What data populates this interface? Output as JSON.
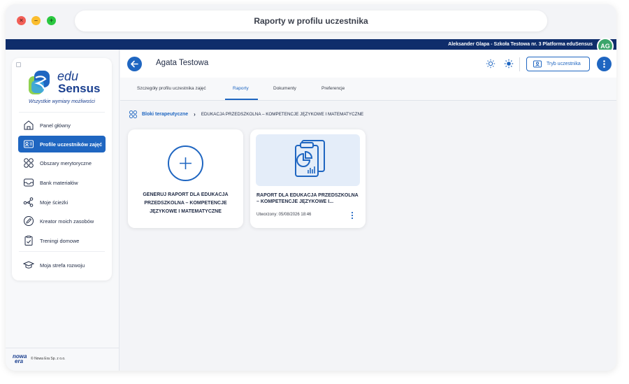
{
  "window": {
    "title": "Raporty w profilu uczestnika"
  },
  "topbar": {
    "user_info": "Aleksander Glapa - Szkoła Testowa nr. 3 Platforma eduSensus",
    "avatar_initials": "AG"
  },
  "colors": {
    "primary": "#1f66c1",
    "navy": "#0f2d6b",
    "avatar": "#3ba56b"
  },
  "sidebar": {
    "logo_line1": "edu",
    "logo_line2": "Sensus",
    "tagline": "Wszystkie wymiary możliwości",
    "items": [
      {
        "label": "Panel główny",
        "icon": "home-icon"
      },
      {
        "label": "Profile uczestników zajęć",
        "icon": "profile-card-icon",
        "active": true
      },
      {
        "label": "Obszary merytoryczne",
        "icon": "grid-icon"
      },
      {
        "label": "Bank materiałów",
        "icon": "inbox-icon"
      },
      {
        "label": "Moje ścieżki",
        "icon": "path-icon"
      },
      {
        "label": "Kreator moich zasobów",
        "icon": "edit-icon"
      },
      {
        "label": "Treningi domowe",
        "icon": "clipboard-check-icon"
      },
      {
        "label": "Moja strefa rozwoju",
        "icon": "graduation-cap-icon"
      }
    ],
    "footer_logo_line1": "nowa",
    "footer_logo_line2": "era",
    "copyright": "© Nowa Era Sp. z o.o."
  },
  "header": {
    "title": "Agata Testowa",
    "mode_button": "Tryb uczestnika"
  },
  "tabs": [
    {
      "label": "Szczegóły profilu uczestnika zajęć"
    },
    {
      "label": "Raporty",
      "active": true
    },
    {
      "label": "Dokumenty"
    },
    {
      "label": "Preferencje"
    }
  ],
  "breadcrumb": {
    "root": "Bloki terapeutyczne",
    "current": "EDUKACJA PRZEDSZKOLNA – KOMPETENCJE JĘZYKOWE I MATEMATYCZNE"
  },
  "cards": {
    "generate": {
      "line1": "GENERUJ RAPORT DLA EDUKACJA",
      "line2": "PRZEDSZKOLNA – KOMPETENCJE",
      "line3": "JĘZYKOWE I MATEMATYCZNE"
    },
    "report": {
      "title_line1": "RAPORT DLA EDUKACJA PRZEDSZKOLNA",
      "title_line2": "– KOMPETENCJE JĘZYKOWE I...",
      "date": "Utworzony: 05/08/2026 18:46"
    }
  }
}
